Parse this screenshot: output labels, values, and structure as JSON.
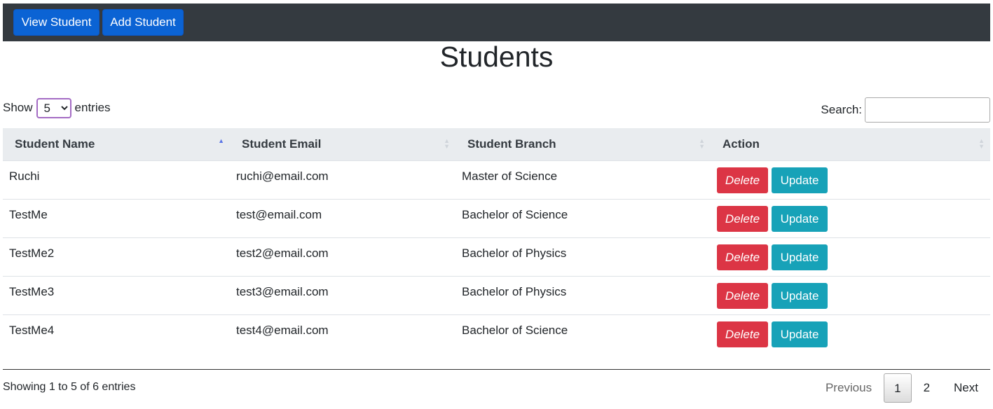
{
  "navbar": {
    "view_label": "View Student",
    "add_label": "Add Student"
  },
  "page": {
    "title": "Students"
  },
  "length": {
    "show_label": "Show",
    "selected": "5",
    "entries_label": "entries"
  },
  "search": {
    "label": "Search:",
    "value": ""
  },
  "table": {
    "headers": [
      "Student Name",
      "Student Email",
      "Student Branch",
      "Action"
    ],
    "rows": [
      {
        "name": "Ruchi",
        "email": "ruchi@email.com",
        "branch": "Master of Science"
      },
      {
        "name": "TestMe",
        "email": "test@email.com",
        "branch": "Bachelor of Science"
      },
      {
        "name": "TestMe2",
        "email": "test2@email.com",
        "branch": "Bachelor of Physics"
      },
      {
        "name": "TestMe3",
        "email": "test3@email.com",
        "branch": "Bachelor of Physics"
      },
      {
        "name": "TestMe4",
        "email": "test4@email.com",
        "branch": "Bachelor of Science"
      }
    ],
    "delete_label": "Delete",
    "update_label": "Update"
  },
  "footer": {
    "info": "Showing 1 to 5 of 6 entries",
    "previous": "Previous",
    "pages": [
      "1",
      "2"
    ],
    "next": "Next"
  },
  "colors": {
    "navbar": "#343a40",
    "primary": "#0b63d4",
    "danger": "#dc3545",
    "info": "#17a2b8"
  }
}
